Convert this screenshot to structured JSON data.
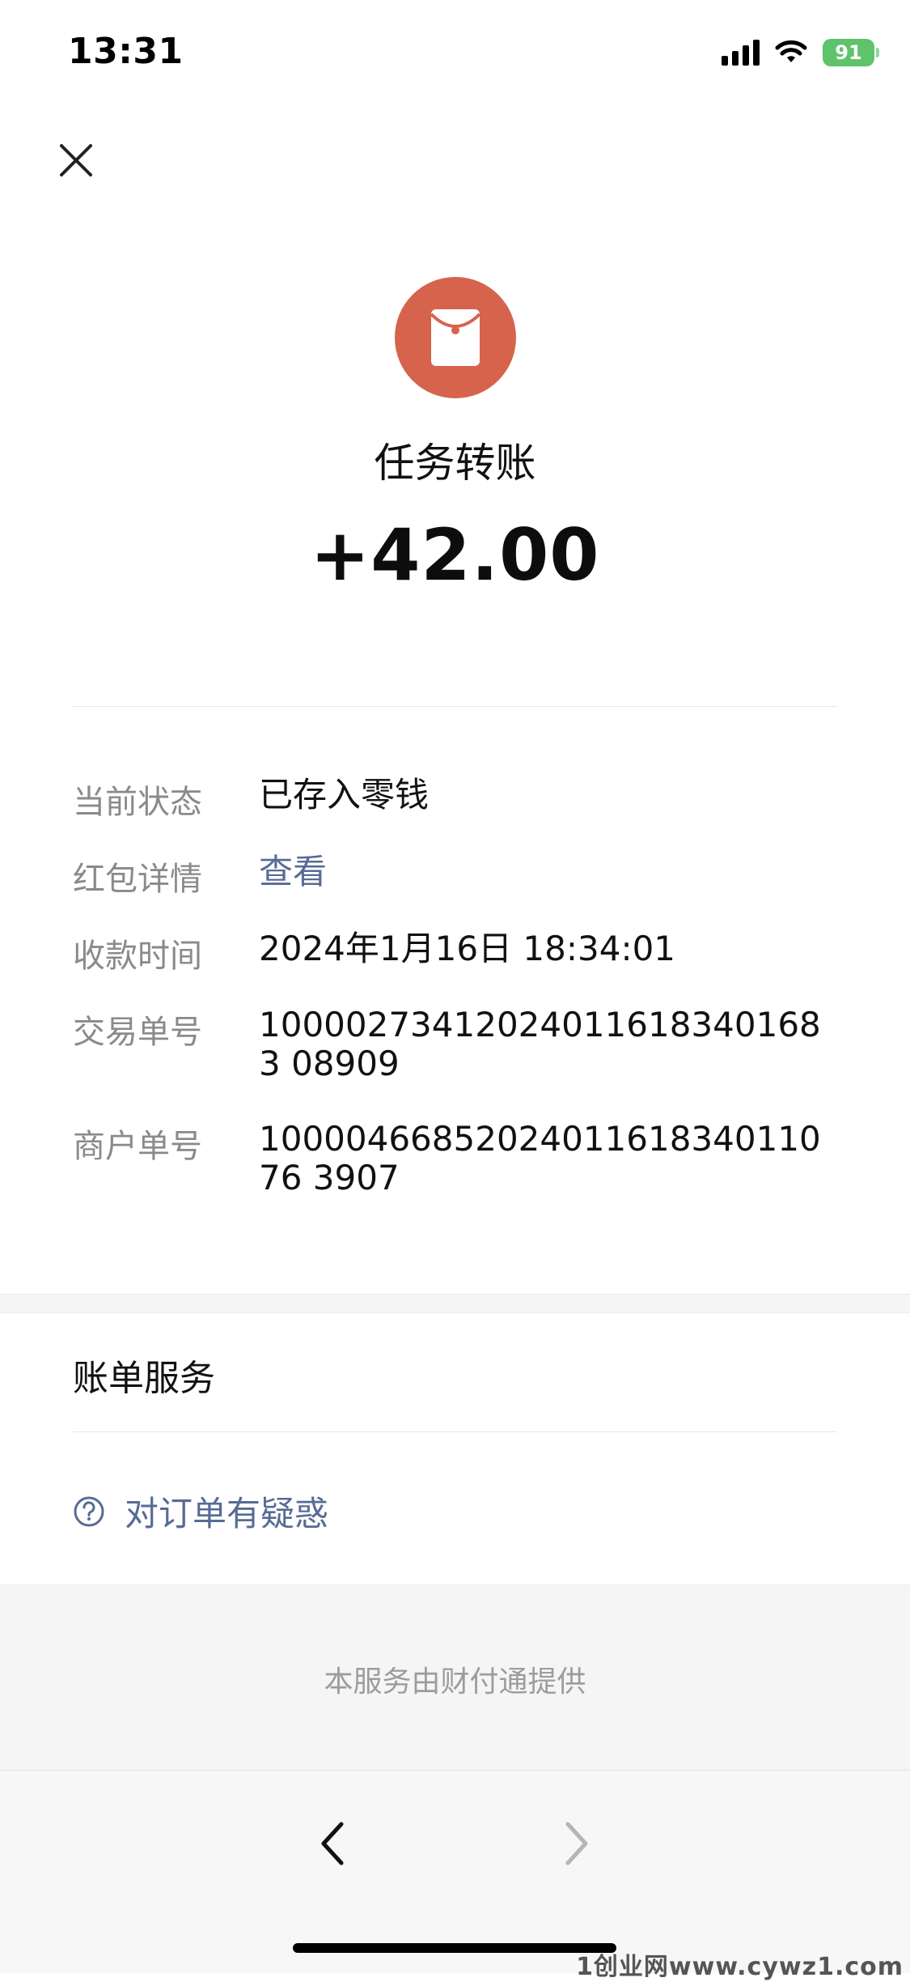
{
  "status_bar": {
    "time": "13:31",
    "battery": "91"
  },
  "header": {
    "close_icon": "close-icon"
  },
  "transaction": {
    "icon": "red-envelope-icon",
    "title": "任务转账",
    "amount": "+42.00"
  },
  "details": [
    {
      "label": "当前状态",
      "value": "已存入零钱"
    },
    {
      "label": "红包详情",
      "value": "查看"
    },
    {
      "label": "收款时间",
      "value": "2024年1月16日 18:34:01"
    },
    {
      "label": "交易单号",
      "value": "100002734120240116183401683 08909"
    },
    {
      "label": "商户单号",
      "value": "1000046685202401161834011076 3907"
    }
  ],
  "bill_service": {
    "title": "账单服务",
    "question_icon": "question-icon",
    "question_label": "对订单有疑惑"
  },
  "footer": {
    "note": "本服务由财付通提供"
  },
  "toolbar": {
    "back_icon": "chevron-left-icon",
    "forward_icon": "chevron-right-icon"
  },
  "watermark": "1创业网www.cywz1.com",
  "colors": {
    "accent_link": "#576b95",
    "envelope": "#d6644d",
    "battery": "#5ec36b"
  }
}
